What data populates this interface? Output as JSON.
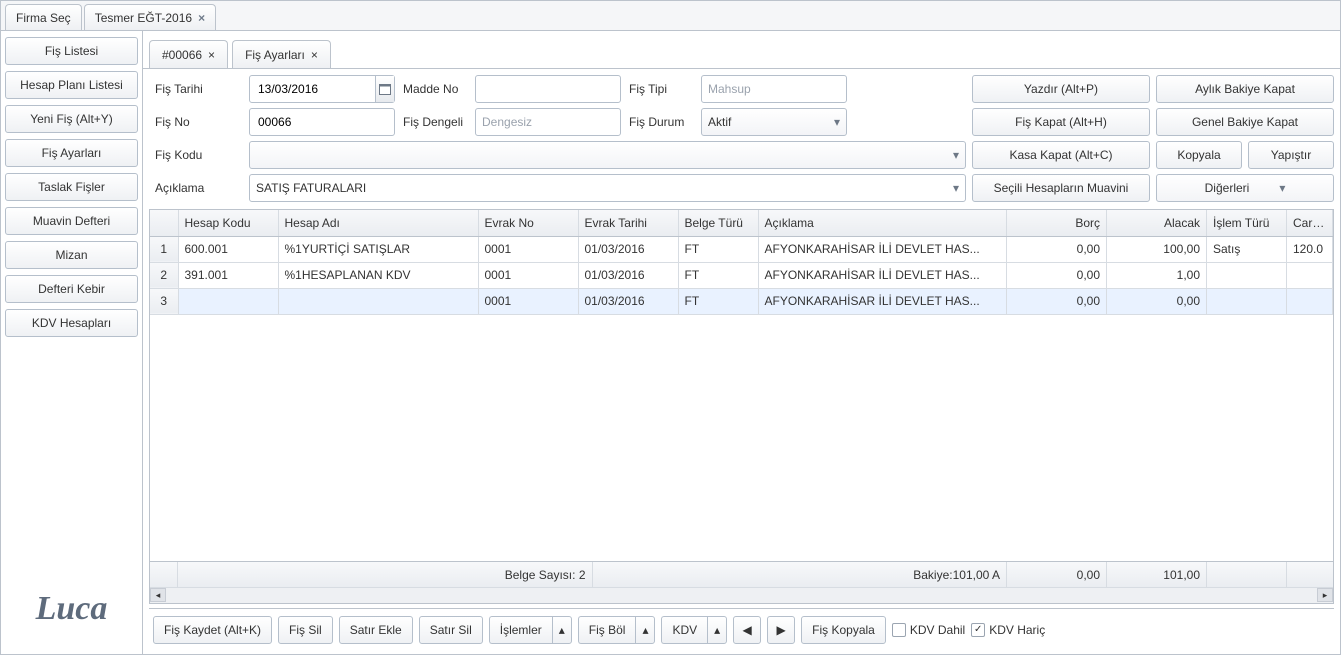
{
  "topTabs": [
    {
      "label": "Firma Seç",
      "closable": false
    },
    {
      "label": "Tesmer EĞT-2016",
      "closable": true
    }
  ],
  "sidebar": {
    "items": [
      "Fiş Listesi",
      "Hesap Planı Listesi",
      "Yeni Fiş (Alt+Y)",
      "Fiş Ayarları",
      "Taslak Fişler",
      "Muavin Defteri",
      "Mizan",
      "Defteri Kebir",
      "KDV Hesapları"
    ],
    "logo": "Luca"
  },
  "innerTabs": [
    {
      "label": "#00066",
      "closable": true
    },
    {
      "label": "Fiş Ayarları",
      "closable": true
    }
  ],
  "form": {
    "labels": {
      "fis_tarihi": "Fiş Tarihi",
      "madde_no": "Madde No",
      "fis_tipi": "Fiş Tipi",
      "fis_no": "Fiş No",
      "fis_dengeli": "Fiş Dengeli",
      "fis_durum": "Fiş Durum",
      "fis_kodu": "Fiş Kodu",
      "aciklama": "Açıklama"
    },
    "values": {
      "fis_tarihi": "13/03/2016",
      "madde_no": "",
      "fis_tipi_placeholder": "Mahsup",
      "fis_no": "00066",
      "fis_dengeli_placeholder": "Dengesiz",
      "fis_durum": "Aktif",
      "fis_kodu": "",
      "aciklama": "SATIŞ FATURALARI"
    },
    "buttons": {
      "yazdir": "Yazdır (Alt+P)",
      "aylik_bakiye": "Aylık Bakiye Kapat",
      "fis_kapat": "Fiş Kapat (Alt+H)",
      "genel_bakiye": "Genel Bakiye Kapat",
      "kasa_kapat": "Kasa Kapat (Alt+C)",
      "kopyala": "Kopyala",
      "yapistir": "Yapıştır",
      "muavin": "Seçili Hesapların Muavini",
      "diger": "Diğerleri"
    }
  },
  "grid": {
    "headers": [
      "",
      "Hesap Kodu",
      "Hesap Adı",
      "Evrak No",
      "Evrak Tarihi",
      "Belge Türü",
      "Açıklama",
      "Borç",
      "Alacak",
      "İşlem Türü",
      "Cari H"
    ],
    "rows": [
      {
        "n": "1",
        "kod": "600.001",
        "ad": "%1YURTİÇİ SATIŞLAR",
        "evrak": "0001",
        "tarih": "01/03/2016",
        "belge": "FT",
        "acik": "AFYONKARAHİSAR İLİ DEVLET HAS...",
        "borc": "0,00",
        "alacak": "100,00",
        "islem": "Satış",
        "cari": "120.0"
      },
      {
        "n": "2",
        "kod": "391.001",
        "ad": "%1HESAPLANAN KDV",
        "evrak": "0001",
        "tarih": "01/03/2016",
        "belge": "FT",
        "acik": "AFYONKARAHİSAR İLİ DEVLET HAS...",
        "borc": "0,00",
        "alacak": "1,00",
        "islem": "",
        "cari": ""
      },
      {
        "n": "3",
        "kod": "",
        "ad": "",
        "evrak": "0001",
        "tarih": "01/03/2016",
        "belge": "FT",
        "acik": "AFYONKARAHİSAR İLİ DEVLET HAS...",
        "borc": "0,00",
        "alacak": "0,00",
        "islem": "",
        "cari": ""
      }
    ],
    "summary": {
      "belge_label": "Belge Sayısı:",
      "belge": "2",
      "bakiye_label": "Bakiye:",
      "bakiye": "101,00 A",
      "borc": "0,00",
      "alacak": "101,00"
    }
  },
  "toolbar": {
    "fis_kaydet": "Fiş Kaydet (Alt+K)",
    "fis_sil": "Fiş Sil",
    "satir_ekle": "Satır Ekle",
    "satir_sil": "Satır Sil",
    "islemler": "İşlemler",
    "fis_bol": "Fiş Böl",
    "kdv": "KDV",
    "fis_kopyala": "Fiş Kopyala",
    "kdv_dahil": "KDV Dahil",
    "kdv_haric": "KDV Hariç"
  }
}
